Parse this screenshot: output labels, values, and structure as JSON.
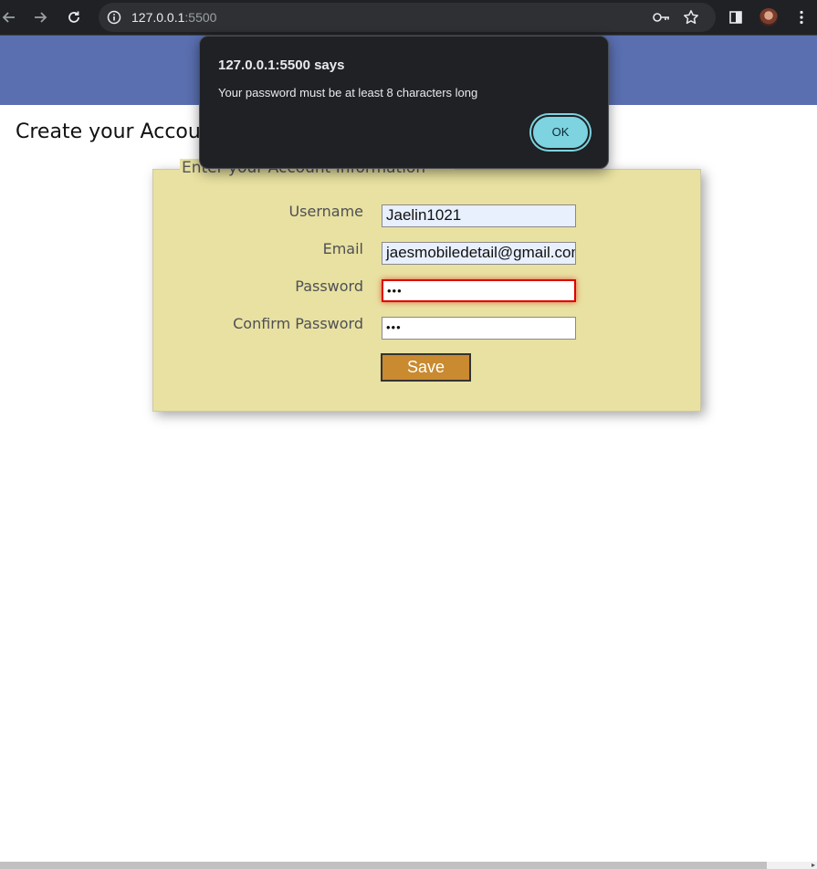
{
  "browser": {
    "url_host": "127.0.0.1",
    "url_port": ":5500",
    "back_icon": "arrow-left-icon",
    "forward_icon": "arrow-right-icon",
    "reload_icon": "reload-icon",
    "info_icon": "info-icon",
    "key_icon": "key-icon",
    "star_icon": "star-icon",
    "sidepanel_icon": "side-panel-icon",
    "menu_icon": "more-vert-icon",
    "header_color": "#5a6fb0"
  },
  "page": {
    "title": "Create your Account",
    "legend": "Enter your Account Information",
    "panel_color": "#e8e1a1"
  },
  "form": {
    "username_label": "Username",
    "username_value": "Jaelin1021",
    "email_label": "Email",
    "email_value": "jaesmobiledetail@gmail.com",
    "password_label": "Password",
    "password_value": "•••",
    "confirm_label": "Confirm Password",
    "confirm_value": "•••",
    "save_label": "Save",
    "save_color": "#c98a30"
  },
  "dialog": {
    "title": "127.0.0.1:5500 says",
    "message": "Your password must be at least 8 characters long",
    "ok_label": "OK",
    "ok_color": "#7dd3e0"
  }
}
